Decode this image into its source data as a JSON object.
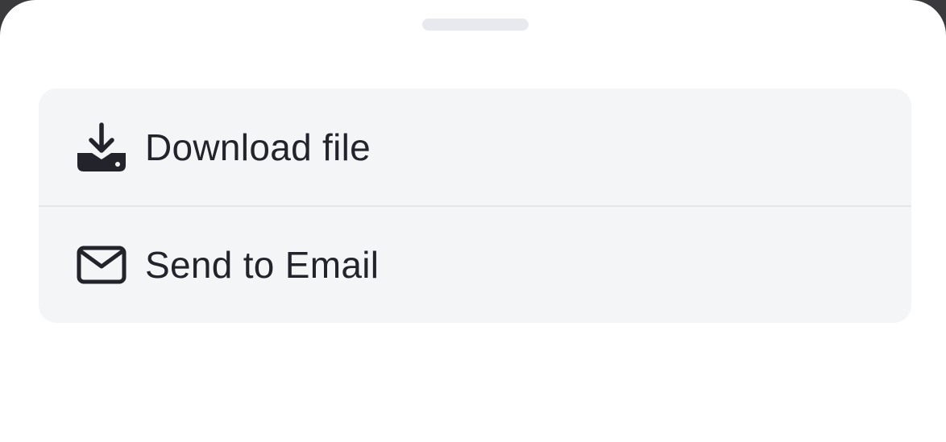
{
  "sheet": {
    "options": [
      {
        "label": "Download file",
        "icon": "download-icon"
      },
      {
        "label": "Send to Email",
        "icon": "mail-icon"
      }
    ]
  },
  "colors": {
    "backdrop": "#3a3a3c",
    "sheet_background": "#ffffff",
    "card_background": "#f4f5f7",
    "text": "#22232b",
    "divider": "#e4e6ea",
    "handle": "#e7e9ee"
  }
}
